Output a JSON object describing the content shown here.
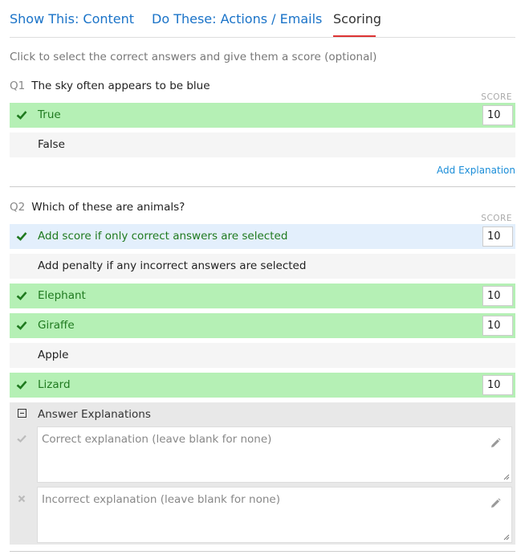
{
  "tabs": [
    {
      "label": "Show This: Content"
    },
    {
      "label": "Do These: Actions / Emails"
    },
    {
      "label": "Scoring"
    }
  ],
  "instructions": "Click to select the correct answers and give them a score (optional)",
  "score_header": "SCORE",
  "q1": {
    "number": "Q1",
    "text": "The sky often appears to be blue",
    "answers": [
      {
        "label": "True",
        "correct": true,
        "score": "10"
      },
      {
        "label": "False",
        "correct": false
      }
    ],
    "add_explanation": "Add Explanation"
  },
  "q2": {
    "number": "Q2",
    "text": "Which of these are animals?",
    "rules": [
      {
        "label": "Add score if only correct answers are selected",
        "selected": true,
        "score": "10"
      },
      {
        "label": "Add penalty if any incorrect answers are selected",
        "selected": false
      }
    ],
    "answers": [
      {
        "label": "Elephant",
        "correct": true,
        "score": "10"
      },
      {
        "label": "Giraffe",
        "correct": true,
        "score": "10"
      },
      {
        "label": "Apple",
        "correct": false
      },
      {
        "label": "Lizard",
        "correct": true,
        "score": "10"
      }
    ]
  },
  "explanations": {
    "title": "Answer Explanations",
    "correct_placeholder": "Correct explanation (leave blank for none)",
    "incorrect_placeholder": "Incorrect explanation (leave blank for none)"
  },
  "colors": {
    "link": "#1a73c8",
    "correct_bg": "#b5f0b5",
    "rule_bg": "#e3effc",
    "active_tab_underline": "#dd3333"
  }
}
